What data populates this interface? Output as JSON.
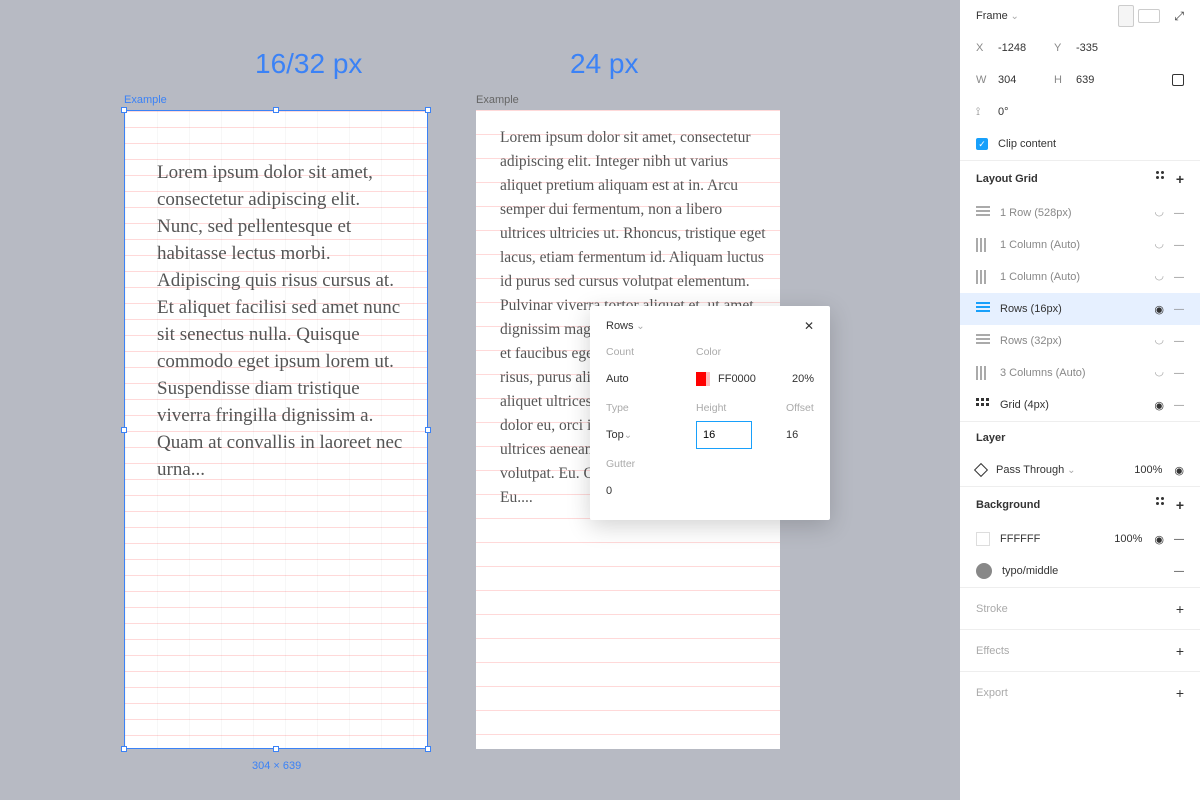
{
  "canvas": {
    "heading1": "16/32 px",
    "heading2": "24 px",
    "frameLabel": "Example",
    "lorem1": "Lorem ipsum dolor sit amet, consectetur adipiscing elit. Nunc, sed pellentesque et habitasse lectus morbi. Adipiscing quis risus cursus at. Et aliquet facilisi sed amet nunc sit senectus nulla. Quisque commodo eget ipsum lorem ut. Suspendisse diam tristique viverra fringilla dignissim a. Quam at convallis in laoreet nec urna...",
    "lorem2": "Lorem ipsum dolor sit amet, consectetur adipiscing elit. Integer nibh ut varius aliquet pretium aliquam est at in. Arcu semper dui fermentum, non a libero ultrices ultricies ut. Rhoncus, tristique eget lacus, etiam fermentum id. Aliquam luctus id purus sed cursus volutpat elementum. Pulvinar viverra tortor aliquet et, ut amet dignissim magna quis bibendum sed ipsum et faucibus eget sit odio pretium, netus cras risus, purus aliquam sed nam. Dui nec aliquet ultrices gravida lacinia urna. Ipsum dolor eu, orci in fermentum euismod ultrices aenean. Quis dolor at amet, volutpat. Eu. Quis dolor at amet, volutpat. Eu....",
    "dimLabel": "304 × 639"
  },
  "transform": {
    "frameTitle": "Frame",
    "x": "-1248",
    "y": "-335",
    "w": "304",
    "h": "639",
    "r": "0°",
    "clip": "Clip content"
  },
  "grid": {
    "title": "Layout Grid",
    "items": [
      {
        "icon": "rows",
        "label": "1 Row (528px)",
        "visible": false
      },
      {
        "icon": "cols",
        "label": "1 Column (Auto)",
        "visible": false
      },
      {
        "icon": "cols",
        "label": "1 Column (Auto)",
        "visible": false
      },
      {
        "icon": "rows",
        "label": "Rows (16px)",
        "visible": true,
        "active": true
      },
      {
        "icon": "rows",
        "label": "Rows (32px)",
        "visible": false
      },
      {
        "icon": "cols",
        "label": "3 Columns (Auto)",
        "visible": false
      },
      {
        "icon": "dots",
        "label": "Grid (4px)",
        "visible": true
      }
    ]
  },
  "layer": {
    "title": "Layer",
    "mode": "Pass Through",
    "opacity": "100%"
  },
  "background": {
    "title": "Background",
    "hex": "FFFFFF",
    "opacity": "100%",
    "styleName": "typo/middle"
  },
  "stroke": {
    "title": "Stroke"
  },
  "effects": {
    "title": "Effects"
  },
  "export": {
    "title": "Export"
  },
  "popup": {
    "title": "Rows",
    "countLabel": "Count",
    "count": "Auto",
    "colorLabel": "Color",
    "colorHex": "FF0000",
    "colorOpacity": "20%",
    "typeLabel": "Type",
    "type": "Top",
    "heightLabel": "Height",
    "height": "16",
    "offsetLabel": "Offset",
    "offset": "16",
    "gutterLabel": "Gutter",
    "gutter": "0"
  }
}
